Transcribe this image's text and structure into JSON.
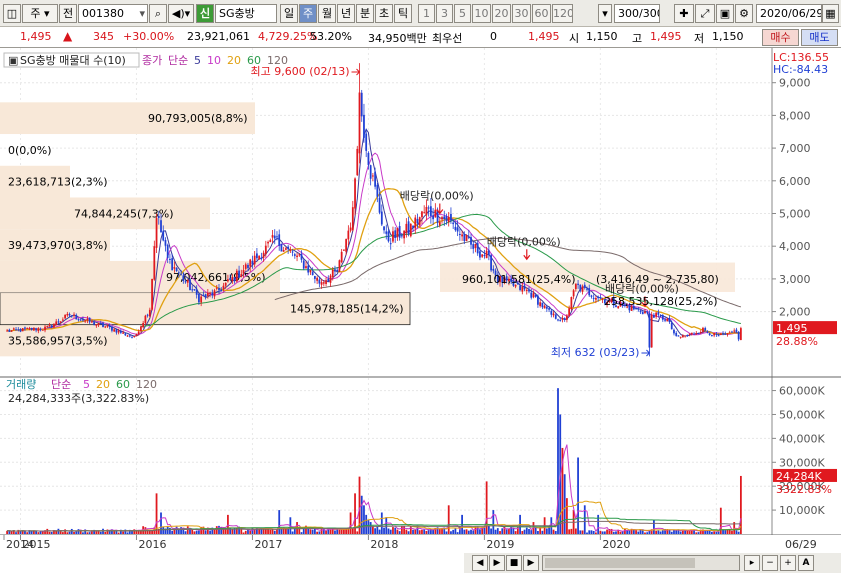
{
  "toolbar": {
    "market_type": "주",
    "full_label": "전",
    "code": "001380",
    "badge": "신",
    "stock_name": "SG충방",
    "periods": [
      "일",
      "주",
      "월",
      "년",
      "분",
      "초",
      "틱"
    ],
    "selected_period": "주",
    "intervals": [
      "1",
      "3",
      "5",
      "10",
      "20",
      "30",
      "60",
      "120"
    ],
    "count": "300",
    "count_max": "/300",
    "date": "2020/06/29"
  },
  "quote": {
    "price": "1,495",
    "price_arrow": "▲",
    "change": "345",
    "change_pct": "+30.00%",
    "volume": "23,921,061",
    "volume_pct": "4,729.25%",
    "turnover": "53.20%",
    "amount": "34,950백만",
    "best_ask_label": "최우선",
    "best_ask": "0",
    "best_bid": "1,495",
    "open_label": "시",
    "open": "1,150",
    "high_label": "고",
    "high": "1,495",
    "low_label": "저",
    "low": "1,150",
    "buy_label": "매수",
    "sell_label": "매도"
  },
  "colors": {
    "up": "#e0191f",
    "down": "#1f3fd4",
    "ma5": "#3a3a9a",
    "ma10": "#c83ac8",
    "ma20": "#e0a010",
    "ma60": "#2a9a4a",
    "ma120": "#7a6a6a",
    "band": "#f8e8d8"
  },
  "chart_data": [
    {
      "type": "candlestick",
      "panel": "price",
      "legend": [
        "SG충방 매물대 수(10)",
        "종가",
        "단순",
        "5",
        "10",
        "20",
        "60",
        "120"
      ],
      "info": [
        "LC:136.55",
        "HC:-84.43"
      ],
      "ylim": [
        0,
        10000
      ],
      "y_ticks": [
        2000,
        3000,
        4000,
        5000,
        6000,
        7000,
        8000,
        9000
      ],
      "y_tick_labels": [
        "2,000",
        "3,000",
        "4,000",
        "5,000",
        "6,000",
        "7,000",
        "8,000",
        "9,000"
      ],
      "x_years": [
        "2014",
        "2015",
        "2016",
        "2017",
        "2018",
        "2019",
        "2020"
      ],
      "x_last_label": "06/29",
      "price_label": "1,495",
      "price_pct": "28.88%",
      "high": {
        "label": "최고 9,600 (02/13)",
        "value": 9600,
        "week": 158
      },
      "low": {
        "label": "최저 632 (03/23)",
        "value": 632,
        "week": 288
      },
      "dividends": [
        {
          "label": "배당락(0,00%)",
          "week": 194,
          "value": 5000
        },
        {
          "label": "배당락(0,00%)",
          "week": 233,
          "value": 3600
        },
        {
          "label": "배당락(0,00%)",
          "week": 286,
          "value": 2160
        }
      ],
      "volume_profile": [
        {
          "label": "35,586,957(3,5%)",
          "price_low": 632,
          "price_high": 1600
        },
        {
          "label": "145,978,185(14,2%)",
          "price_low": 1600,
          "price_high": 2580
        },
        {
          "label": "97,042,661(9,5%)",
          "price_low": 2580,
          "price_high": 3550
        },
        {
          "label": "39,473,970(3,8%)",
          "price_low": 3550,
          "price_high": 4520
        },
        {
          "label": "74,844,245(7,3%)",
          "price_low": 4520,
          "price_high": 5490
        },
        {
          "label": "23,618,713(2,3%)",
          "price_low": 5490,
          "price_high": 6460
        },
        {
          "label": "0(0,0%)",
          "price_low": 6460,
          "price_high": 7430
        },
        {
          "label": "90,793,005(8,8%)",
          "price_low": 7430,
          "price_high": 8400
        }
      ],
      "overlay_labels": [
        "960,101,581(25,4%)",
        "(3,416,49 ~ 2,735,80)",
        "258,535,128(25,2%)"
      ],
      "anchors": [
        [
          0,
          1400
        ],
        [
          18,
          1500
        ],
        [
          28,
          1900
        ],
        [
          36,
          1700
        ],
        [
          46,
          1500
        ],
        [
          57,
          1200
        ],
        [
          64,
          2100
        ],
        [
          67,
          5000
        ],
        [
          72,
          3600
        ],
        [
          86,
          2400
        ],
        [
          94,
          2600
        ],
        [
          108,
          3400
        ],
        [
          120,
          4200
        ],
        [
          131,
          3600
        ],
        [
          140,
          2900
        ],
        [
          148,
          3200
        ],
        [
          155,
          5000
        ],
        [
          158,
          8500
        ],
        [
          163,
          6300
        ],
        [
          170,
          4200
        ],
        [
          180,
          4500
        ],
        [
          188,
          5100
        ],
        [
          198,
          4800
        ],
        [
          208,
          4000
        ],
        [
          215,
          3700
        ],
        [
          220,
          3000
        ],
        [
          234,
          2600
        ],
        [
          244,
          1900
        ],
        [
          250,
          1700
        ],
        [
          255,
          2800
        ],
        [
          260,
          2600
        ],
        [
          270,
          2300
        ],
        [
          280,
          2100
        ],
        [
          290,
          1900
        ],
        [
          296,
          1750
        ],
        [
          300,
          1200
        ],
        [
          306,
          1300
        ],
        [
          312,
          1450
        ],
        [
          318,
          1250
        ],
        [
          324,
          1300
        ],
        [
          328,
          1495
        ]
      ]
    },
    {
      "type": "bar",
      "panel": "volume",
      "legend": [
        "거래량",
        "단순",
        "5",
        "20",
        "60",
        "120"
      ],
      "info": "24,284,333주(3,322.83%)",
      "ylim": [
        0,
        64000
      ],
      "y_ticks": [
        10000,
        20000,
        30000,
        40000,
        50000,
        60000
      ],
      "y_tick_labels": [
        "10,000K",
        "20,000K",
        "30,000K",
        "40,000K",
        "50,000K",
        "60,000K"
      ],
      "current_label": "24,284K",
      "current_pct": "3322.83%",
      "spikes": [
        [
          67,
          17000
        ],
        [
          69,
          9000
        ],
        [
          99,
          8000
        ],
        [
          122,
          10000
        ],
        [
          127,
          7000
        ],
        [
          130,
          5000
        ],
        [
          154,
          9000
        ],
        [
          156,
          17000
        ],
        [
          158,
          24000
        ],
        [
          159,
          16000
        ],
        [
          160,
          12000
        ],
        [
          161,
          8000
        ],
        [
          162,
          6000
        ],
        [
          163,
          5000
        ],
        [
          168,
          9000
        ],
        [
          170,
          7000
        ],
        [
          198,
          12000
        ],
        [
          204,
          8000
        ],
        [
          215,
          22000
        ],
        [
          218,
          10000
        ],
        [
          230,
          8000
        ],
        [
          236,
          5000
        ],
        [
          241,
          7000
        ],
        [
          244,
          7000
        ],
        [
          247,
          61000
        ],
        [
          248,
          50000
        ],
        [
          249,
          36000
        ],
        [
          250,
          25000
        ],
        [
          251,
          15000
        ],
        [
          254,
          10000
        ],
        [
          256,
          32000
        ],
        [
          259,
          12000
        ],
        [
          265,
          8000
        ],
        [
          290,
          6000
        ],
        [
          320,
          11000
        ],
        [
          326,
          5000
        ],
        [
          329,
          24284
        ]
      ]
    }
  ]
}
